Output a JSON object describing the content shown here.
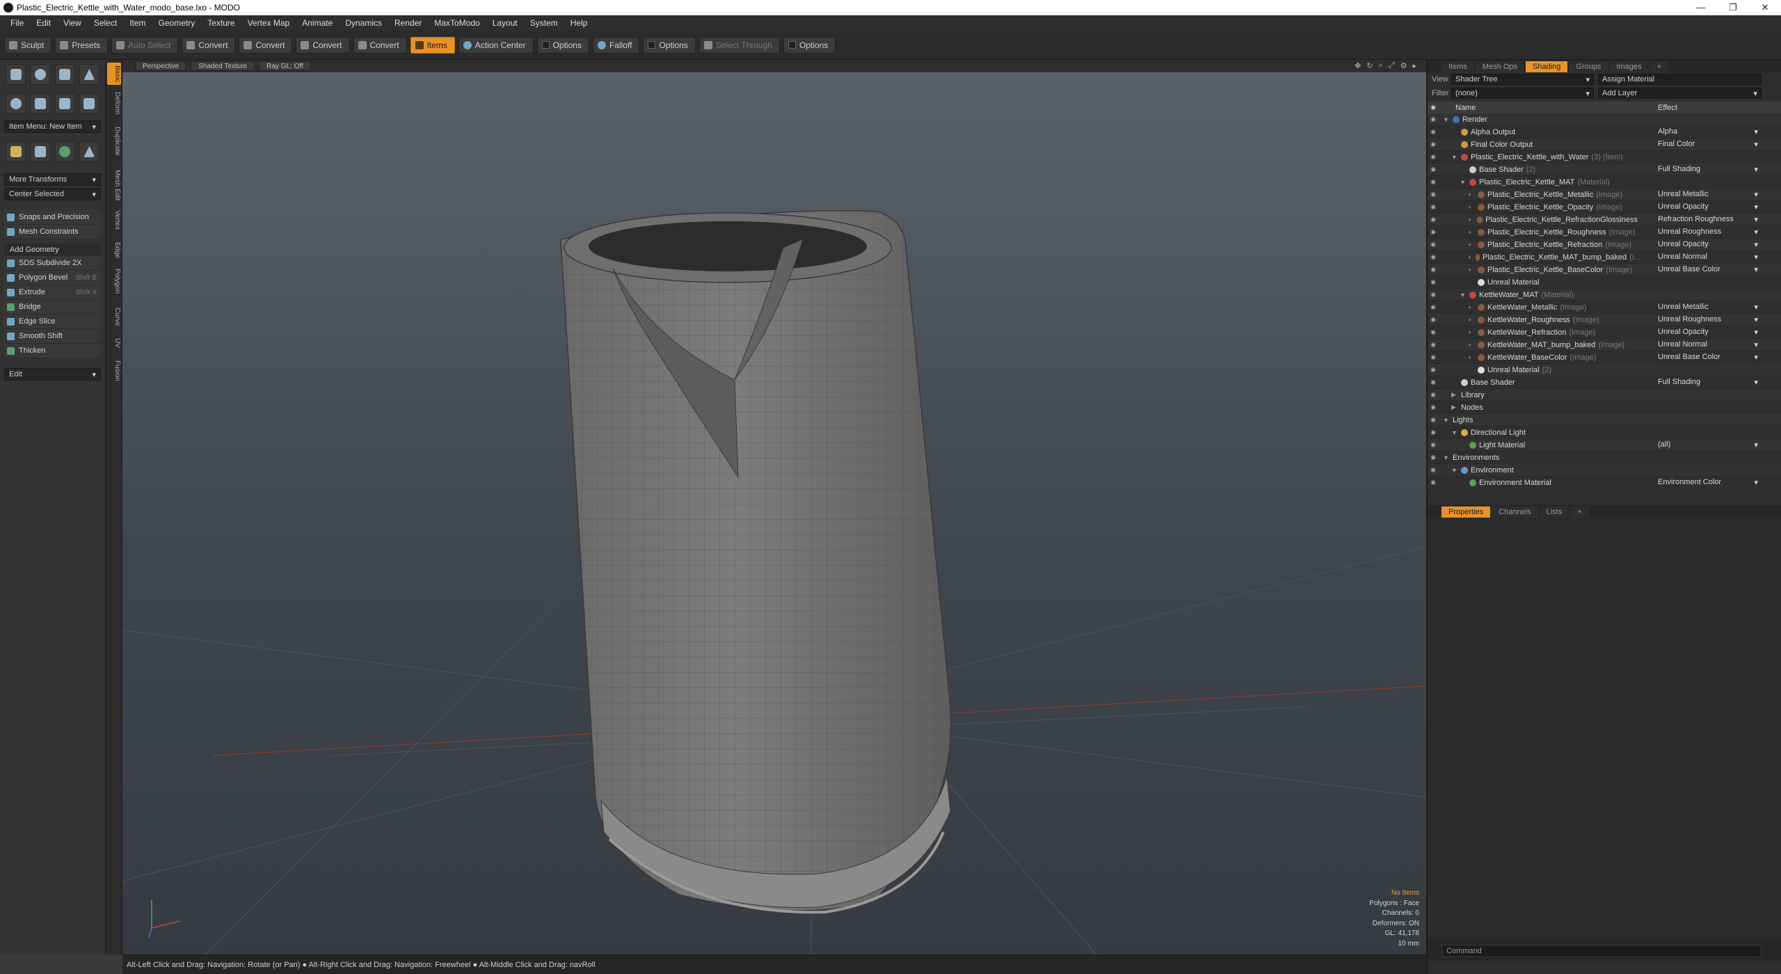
{
  "window": {
    "title": "Plastic_Electric_Kettle_with_Water_modo_base.lxo - MODO",
    "controls": [
      "—",
      "❐",
      "✕"
    ]
  },
  "menu": [
    "File",
    "Edit",
    "View",
    "Select",
    "Item",
    "Geometry",
    "Texture",
    "Vertex Map",
    "Animate",
    "Dynamics",
    "Render",
    "MaxToModo",
    "Layout",
    "System",
    "Help"
  ],
  "toolbar": {
    "sculpt": "Sculpt",
    "presets": "Presets",
    "auto_select": "Auto Select",
    "convert1": "Convert",
    "convert2": "Convert",
    "convert3": "Convert",
    "convert4": "Convert",
    "items": "Items",
    "action_center": "Action Center",
    "options1": "Options",
    "falloff": "Falloff",
    "options2": "Options",
    "select_through": "Select Through",
    "options3": "Options"
  },
  "left": {
    "item_menu": "Item Menu: New Item",
    "more_transforms": "More Transforms",
    "center_selected": "Center Selected",
    "snaps": "Snaps and Precision",
    "mesh_constraints": "Mesh Constraints",
    "add_geometry": "Add Geometry",
    "tools": [
      {
        "label": "SDS Subdivide 2X",
        "shortcut": ""
      },
      {
        "label": "Polygon Bevel",
        "shortcut": "Shift-B"
      },
      {
        "label": "Extrude",
        "shortcut": "Shift-X"
      },
      {
        "label": "Bridge",
        "shortcut": ""
      },
      {
        "label": "Edge Slice",
        "shortcut": ""
      },
      {
        "label": "Smooth Shift",
        "shortcut": ""
      },
      {
        "label": "Thicken",
        "shortcut": ""
      }
    ],
    "edit": "Edit",
    "vtabs": [
      "Basic",
      "Deform",
      "Duplicate",
      "Mesh Edit",
      "Vertex",
      "Edge",
      "Polygon",
      "Curve",
      "UV",
      "Fusion"
    ]
  },
  "viewport": {
    "view_mode": "Perspective",
    "shading": "Shaded Texture",
    "raygl": "Ray GL: Off",
    "stats": {
      "no_items": "No Items",
      "polygons": "Polygons : Face",
      "channels": "Channels: 0",
      "deformers": "Deformers: ON",
      "gl": "GL: 41,178",
      "units": "10 mm"
    }
  },
  "statusbar": "Alt-Left Click and Drag: Navigation: Rotate (or Pan) ● Alt-Right Click and Drag: Navigation: Freewheel ● Alt-Middle Click and Drag: navRoll",
  "right": {
    "tabs": [
      "Items",
      "Mesh Ops",
      "Shading",
      "Groups",
      "Images",
      "+"
    ],
    "view_label": "View",
    "view_value": "Shader Tree",
    "assign_material": "Assign Material",
    "filter_label": "Filter",
    "filter_value": "(none)",
    "add_layer": "Add Layer",
    "col_name": "Name",
    "col_effect": "Effect",
    "tree": [
      {
        "indent": 0,
        "arrow": "▼",
        "name": "Render",
        "tag": "",
        "effect": "",
        "color": "#4a6fb8"
      },
      {
        "indent": 1,
        "arrow": "",
        "name": "Alpha Output",
        "tag": "",
        "effect": "Alpha",
        "color": "#c89c4a"
      },
      {
        "indent": 1,
        "arrow": "",
        "name": "Final Color Output",
        "tag": "",
        "effect": "Final Color",
        "color": "#c89c4a"
      },
      {
        "indent": 1,
        "arrow": "▼",
        "name": "Plastic_Electric_Kettle_with_Water",
        "tag": "(3) (Item)",
        "effect": "",
        "color": "#b84a4a"
      },
      {
        "indent": 2,
        "arrow": "",
        "name": "Base Shader",
        "tag": "(2)",
        "effect": "Full Shading",
        "color": "#cfcfcf"
      },
      {
        "indent": 2,
        "arrow": "▼",
        "name": "Plastic_Electric_Kettle_MAT",
        "tag": "(Material)",
        "effect": "",
        "color": "#c44848"
      },
      {
        "indent": 3,
        "arrow": "+",
        "name": "Plastic_Electric_Kettle_Metallic",
        "tag": "(Image)",
        "effect": "Unreal Metallic",
        "color": "#8a5a3a"
      },
      {
        "indent": 3,
        "arrow": "+",
        "name": "Plastic_Electric_Kettle_Opacity",
        "tag": "(Image)",
        "effect": "Unreal Opacity",
        "color": "#8a5a3a"
      },
      {
        "indent": 3,
        "arrow": "+",
        "name": "Plastic_Electric_Kettle_RefractionGlossiness",
        "tag": "",
        "effect": "Refraction Roughness",
        "color": "#8a5a3a"
      },
      {
        "indent": 3,
        "arrow": "+",
        "name": "Plastic_Electric_Kettle_Roughness",
        "tag": "(Image)",
        "effect": "Unreal Roughness",
        "color": "#8a5a3a"
      },
      {
        "indent": 3,
        "arrow": "+",
        "name": "Plastic_Electric_Kettle_Refraction",
        "tag": "(Image)",
        "effect": "Unreal Opacity",
        "color": "#8a5a3a"
      },
      {
        "indent": 3,
        "arrow": "+",
        "name": "Plastic_Electric_Kettle_MAT_bump_baked",
        "tag": "(I...",
        "effect": "Unreal Normal",
        "color": "#8a5a3a"
      },
      {
        "indent": 3,
        "arrow": "+",
        "name": "Plastic_Electric_Kettle_BaseColor",
        "tag": "(Image)",
        "effect": "Unreal Base Color",
        "color": "#8a5a3a"
      },
      {
        "indent": 3,
        "arrow": "",
        "name": "Unreal Material",
        "tag": "",
        "effect": "",
        "color": "#dddddd"
      },
      {
        "indent": 2,
        "arrow": "▼",
        "name": "KettleWater_MAT",
        "tag": "(Material)",
        "effect": "",
        "color": "#c44848"
      },
      {
        "indent": 3,
        "arrow": "+",
        "name": "KettleWater_Metallic",
        "tag": "(Image)",
        "effect": "Unreal Metallic",
        "color": "#8a5a3a"
      },
      {
        "indent": 3,
        "arrow": "+",
        "name": "KettleWater_Roughness",
        "tag": "(Image)",
        "effect": "Unreal Roughness",
        "color": "#8a5a3a"
      },
      {
        "indent": 3,
        "arrow": "+",
        "name": "KettleWater_Refraction",
        "tag": "(Image)",
        "effect": "Unreal Opacity",
        "color": "#8a5a3a"
      },
      {
        "indent": 3,
        "arrow": "+",
        "name": "KettleWater_MAT_bump_baked",
        "tag": "(Image)",
        "effect": "Unreal Normal",
        "color": "#8a5a3a"
      },
      {
        "indent": 3,
        "arrow": "+",
        "name": "KettleWater_BaseColor",
        "tag": "(Image)",
        "effect": "Unreal Base Color",
        "color": "#8a5a3a"
      },
      {
        "indent": 3,
        "arrow": "",
        "name": "Unreal Material",
        "tag": "(2)",
        "effect": "",
        "color": "#dddddd"
      },
      {
        "indent": 1,
        "arrow": "",
        "name": "Base Shader",
        "tag": "",
        "effect": "Full Shading",
        "color": "#cfcfcf"
      },
      {
        "indent": 1,
        "arrow": "▶",
        "name": "Library",
        "tag": "",
        "effect": "",
        "color": ""
      },
      {
        "indent": 1,
        "arrow": "▶",
        "name": "Nodes",
        "tag": "",
        "effect": "",
        "color": ""
      },
      {
        "indent": 0,
        "arrow": "▼",
        "name": "Lights",
        "tag": "",
        "effect": "",
        "color": ""
      },
      {
        "indent": 1,
        "arrow": "▼",
        "name": "Directional Light",
        "tag": "",
        "effect": "",
        "color": "#d8b040"
      },
      {
        "indent": 2,
        "arrow": "",
        "name": "Light Material",
        "tag": "",
        "effect": "(all)",
        "color": "#5aa05a"
      },
      {
        "indent": 0,
        "arrow": "▼",
        "name": "Environments",
        "tag": "",
        "effect": "",
        "color": ""
      },
      {
        "indent": 1,
        "arrow": "▼",
        "name": "Environment",
        "tag": "",
        "effect": "",
        "color": "#6a9ad0"
      },
      {
        "indent": 2,
        "arrow": "",
        "name": "Environment Material",
        "tag": "",
        "effect": "Environment Color",
        "color": "#5aa05a"
      }
    ],
    "prop_tabs": [
      "Properties",
      "Channels",
      "Lists",
      "+"
    ],
    "command_placeholder": "Command"
  }
}
